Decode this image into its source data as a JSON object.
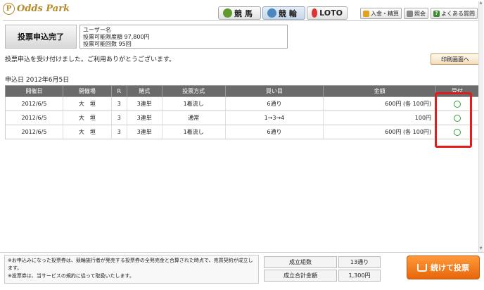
{
  "brand": {
    "mark": "P",
    "name": "Odds Park"
  },
  "nav": {
    "tabs": [
      {
        "label": "競 馬",
        "icon": "horse-icon"
      },
      {
        "label": "競 輪",
        "icon": "bicycle-icon"
      },
      {
        "label": "LOTO",
        "icon": "loto-icon"
      }
    ],
    "utility": [
      {
        "label": "入金・精算",
        "icon": "coin-icon"
      },
      {
        "label": "照会",
        "icon": "document-icon"
      },
      {
        "label": "よくある質問",
        "icon": "question-icon",
        "glyph": "?"
      }
    ]
  },
  "status": {
    "complete_label": "投票申込完了"
  },
  "user": {
    "name": "ユーザー名",
    "limit_amount": "投票可能限度額  97,800円",
    "limit_count": "投票可能回数  95回"
  },
  "message": "投票申込を受け付けました。ご利用ありがとうございます。",
  "print_button": "印刷画面へ",
  "application_date": "申込日  2012年6月5日",
  "table": {
    "headers": [
      "開催日",
      "開催場",
      "R",
      "賭式",
      "投票方式",
      "買い目",
      "金額",
      "受付"
    ],
    "rows": [
      {
        "date": "2012/6/5",
        "venue": "大　垣",
        "race": "3",
        "bet_type": "3連単",
        "method": "1着流し",
        "selection": "6通り",
        "amount": "600円 (各 100円)"
      },
      {
        "date": "2012/6/5",
        "venue": "大　垣",
        "race": "3",
        "bet_type": "3連単",
        "method": "通常",
        "selection": "1→3→4",
        "amount": "100円"
      },
      {
        "date": "2012/6/5",
        "venue": "大　垣",
        "race": "3",
        "bet_type": "3連単",
        "method": "1着流し",
        "selection": "6通り",
        "amount": "600円 (各 100円)"
      }
    ]
  },
  "notes": {
    "line1": "※お申込みになった投票券は、競輪施行者が発売する投票券の全発売金と合算された時点で、売買契約が成立します。",
    "line2": "※投票券は、当サービスの規約に従って取扱いたします。"
  },
  "summary": {
    "combos_label": "成立組数",
    "combos_value": "13通り",
    "total_label": "成立合計金額",
    "total_value": "1,300円"
  },
  "continue_button": "続けて投票",
  "colors": {
    "brand_gold": "#b58a2a",
    "header_gray": "#6b6b6b",
    "accepted_green": "#2fa12f",
    "highlight_red": "#e21b1b",
    "continue_orange": "#f07a1e"
  }
}
